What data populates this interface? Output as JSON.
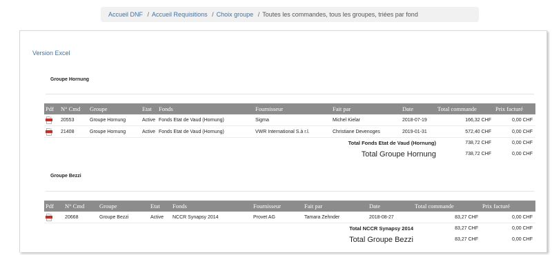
{
  "breadcrumb": {
    "items": [
      "Accueil DNF",
      "Accueil Requisitions",
      "Choix groupe"
    ],
    "separator": "/",
    "current": "Toutes les commandes, tous les groupes, triées par fond"
  },
  "excel_link": "Version Excel",
  "table_headers": {
    "pdf": "Pdf",
    "cmd": "N° Cmd",
    "groupe": "Groupe",
    "etat": "Etat",
    "fonds": "Fonds",
    "fournisseur": "Fournisseur",
    "fait_par": "Fait par",
    "date": "Date",
    "total": "Total commande",
    "prix": "Prix facturé"
  },
  "groups": [
    {
      "title": "Groupe Hornung",
      "rows": [
        {
          "cmd": "20553",
          "groupe": "Groupe Hornung",
          "etat": "Active",
          "fonds": "Fonds Etat de Vaud (Hornung)",
          "fournisseur": "Sigma",
          "fait_par": "Michel Kielar",
          "date": "2018-07-19",
          "total": "166,32 CHF",
          "prix": "0,00 CHF"
        },
        {
          "cmd": "21408",
          "groupe": "Groupe Hornung",
          "etat": "Active",
          "fonds": "Fonds Etat de Vaud (Hornung)",
          "fournisseur": "VWR International S.à r.l.",
          "fait_par": "Christiane Devenoges",
          "date": "2019-01-31",
          "total": "572,40 CHF",
          "prix": "0,00 CHF"
        }
      ],
      "total_fond_label": "Total Fonds Etat de Vaud (Hornung)",
      "total_fond_value": "738,72 CHF",
      "total_fond_prix": "0,00 CHF",
      "total_group_label": "Total Groupe Hornung",
      "total_group_value": "738,72 CHF",
      "total_group_prix": "0,00 CHF"
    },
    {
      "title": "Groupe Bezzi",
      "rows": [
        {
          "cmd": "20668",
          "groupe": "Groupe Bezzi",
          "etat": "Active",
          "fonds": "NCCR Synapsy 2014",
          "fournisseur": "Provet AG",
          "fait_par": "Tamara Zehnder",
          "date": "2018-08-27",
          "total": "83,27 CHF",
          "prix": "0,00 CHF"
        }
      ],
      "total_fond_label": "Total NCCR Synapsy 2014",
      "total_fond_value": "83,27 CHF",
      "total_fond_prix": "0,00 CHF",
      "total_group_label": "Total Groupe Bezzi",
      "total_group_value": "83,27 CHF",
      "total_group_prix": "0,00 CHF"
    }
  ],
  "icons": {
    "pdf": "pdf-file-icon"
  },
  "colors": {
    "header_bg": "#8c8c8c",
    "link": "#3a73b5",
    "pdf_red": "#d8251e"
  }
}
